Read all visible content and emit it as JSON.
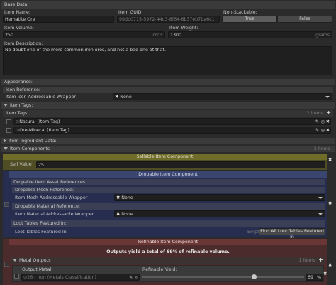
{
  "base": {
    "section": "Base Data:",
    "item_name_label": "Item Name:",
    "item_name": "Hematite Ore",
    "guid_label": "Item GUID:",
    "guid": "99db0715-5972-44d3-8f64-6b37eb7ba6c1",
    "nonstack_label": "Non-Stackable:",
    "true_label": "True",
    "false_label": "False",
    "volume_label": "Item Volume:",
    "volume": "250",
    "volume_unit": "cm3",
    "weight_label": "Item Weight:",
    "weight": "1300",
    "weight_unit": "grams",
    "desc_label": "Item Description:",
    "desc": "No doubt one of the more common iron ores, and not a bad one at that."
  },
  "appearance": {
    "section": "Appearance:",
    "icon_ref": "Icon Reference:",
    "icon_wrapper_label": "Item Icon Addressable Wrapper",
    "icon_wrapper_value": "None"
  },
  "tags": {
    "section": "Item Tags:",
    "list_label": "Item Tags",
    "count": "2 items",
    "items": [
      "Natural (Item Tag)",
      "Ore-Mineral (Item Tag)"
    ]
  },
  "ingredient": {
    "section": "Item Ingredient Data:"
  },
  "components": {
    "section": "Item Components",
    "count": "3 items",
    "sellable": {
      "title": "Sellable Item Component",
      "sell_label": "Sell Value",
      "sell_value": "25"
    },
    "droppable": {
      "title": "Dropable Item Component",
      "asset_refs": "Dropable Item Asset References:",
      "mesh_ref": "Dropable Mesh Reference:",
      "mesh_label": "Item Mesh Addressable Wrapper",
      "mesh_value": "None",
      "mat_ref": "Dropable Material Reference:",
      "mat_label": "Item Material Addressable Wrapper",
      "mat_value": "None",
      "loot_header": "Loot Tables Featured In:",
      "loot_label": "Loot Tables Featured In",
      "loot_empty": "Empty",
      "loot_button": "Find All Loot Tables Featured In"
    },
    "refinable": {
      "title": "Refinable Item Component",
      "yield_note": "Outputs yield a total of 69% of refinable volume.",
      "outputs_label": "Metal Outputs",
      "outputs_count": "1 items",
      "output_metal_label": "Output Metal:",
      "output_metal_value": "26 - Iron (Metals Classification)",
      "yield_label": "Refinable Yield:",
      "yield_value": "69",
      "yield_unit": "%",
      "yield_fraction": 0.69
    }
  },
  "colors": {
    "sellable_bg": "#4e4d24",
    "sellable_header": "#706d2a",
    "droppable_bg": "#262d4f",
    "droppable_header": "#3a4570",
    "refinable_bg": "#4b2b2b",
    "refinable_header": "#6b3636"
  }
}
